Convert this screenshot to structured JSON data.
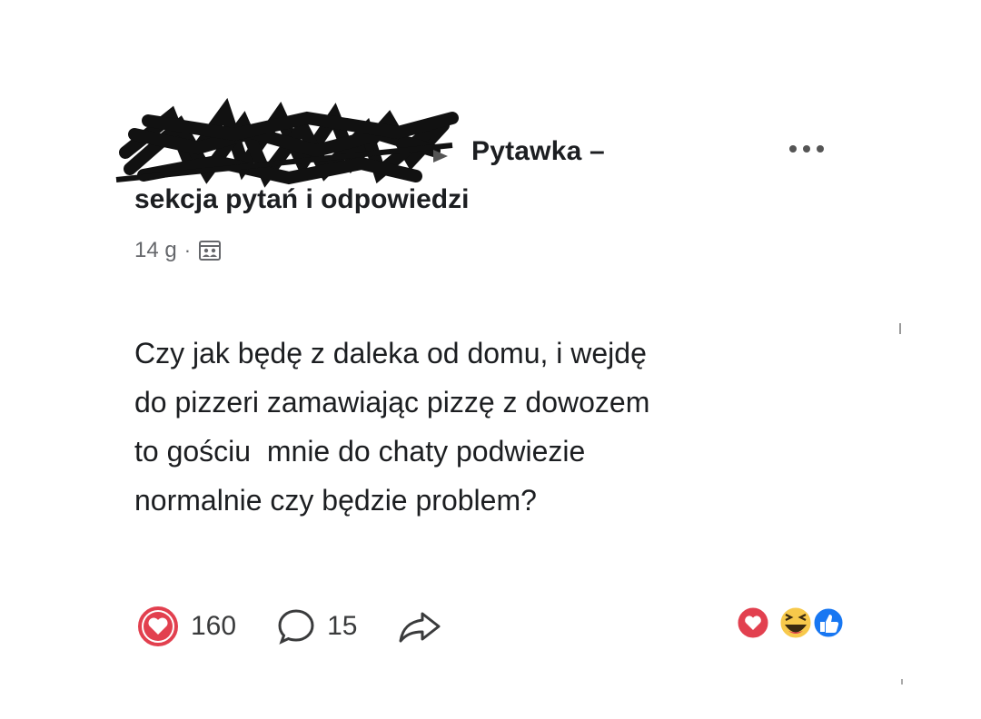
{
  "post": {
    "group_name_line1": "Pytawka –",
    "group_name_line2": "sekcja pytań i odpowiedzi",
    "timestamp": "14 g",
    "separator": "·",
    "privacy_icon": "group-audience-icon",
    "more_icon": "more-options-icon",
    "body_lines": [
      "Czy jak będę z daleka od domu, i wejdę",
      "do pizzeri zamawiając pizzę z dowozem",
      "to gościu  mnie do chaty podwiezie",
      "normalnie czy będzie problem?"
    ],
    "author_redacted": true
  },
  "actions": {
    "like_count": "160",
    "comment_count": "15",
    "like_icon": "heart-icon",
    "comment_icon": "comment-icon",
    "share_icon": "share-icon"
  },
  "reactions_summary": {
    "icons": [
      "love-reaction-icon",
      "haha-reaction-icon",
      "like-reaction-icon"
    ]
  },
  "colors": {
    "text": "#1c1e21",
    "meta": "#65676b",
    "love_red": "#e2404f",
    "like_blue": "#1877f2",
    "haha_yellow": "#f7c94b"
  }
}
